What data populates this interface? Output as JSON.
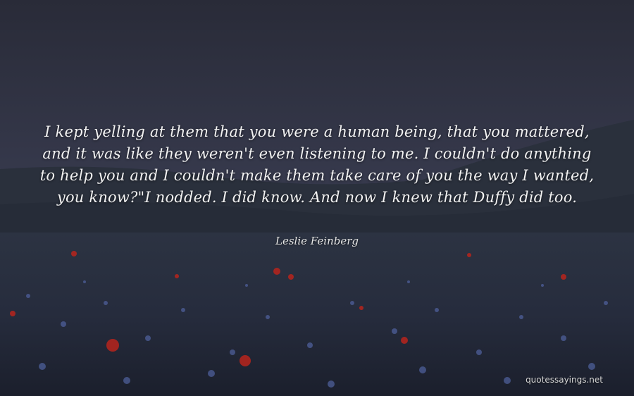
{
  "quote": {
    "lines": [
      "I kept yelling at them that you were a human being, that you mattered,",
      "and it was like they weren't even listening to me. I couldn't do anything",
      "to help you and I couldn't make them take care of you the way I wanted,",
      "you know?\"I nodded. I did know. And now I knew that Duffy did too."
    ],
    "author": "Leslie Feinberg"
  },
  "watermark": "quotessayings.net",
  "colors": {
    "text": "#f2f2f2",
    "sky": "#34364a",
    "field": "#1c1f2e",
    "poppy": "#b8241c",
    "cornflower": "#5a6fb0"
  }
}
